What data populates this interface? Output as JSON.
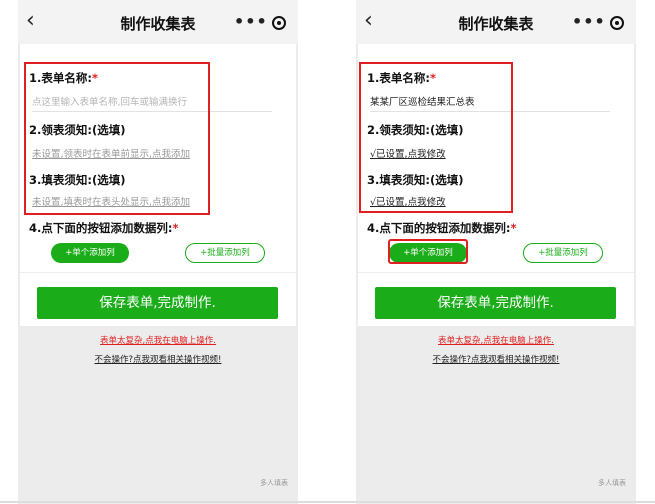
{
  "left": {
    "nav": {
      "back": "‹",
      "title": "制作收集表",
      "dots": "•••"
    },
    "form": {
      "name_label": "1.表单名称:",
      "required": "*",
      "name_placeholder": "点这里输入表单名称,回车或输满换行",
      "notice1_label": "2.领表须知:(选填)",
      "notice1_link": "未设置,领表时在表单前显示,点我添加",
      "notice2_label": "3.填表须知:(选填)",
      "notice2_link": "未设置,填表时在表头处显示,点我添加",
      "cols_label": "4.点下面的按钮添加数据列:",
      "add_single": "+单个添加列",
      "add_batch": "+批量添加列",
      "save": "保存表单,完成制作."
    },
    "link_complex": "表单太复杂,点我在电脑上操作.",
    "link_video": "不会操作?点我观看相关操作视频!",
    "watermark": "多人填表"
  },
  "right": {
    "nav": {
      "back": "‹",
      "title": "制作收集表",
      "dots": "•••"
    },
    "form": {
      "name_label": "1.表单名称:",
      "required": "*",
      "name_value": "某某厂区巡检结果汇总表",
      "notice1_label": "2.领表须知:(选填)",
      "notice1_link": "√已设置,点我修改",
      "notice2_label": "3.填表须知:(选填)",
      "notice2_link": "√已设置,点我修改",
      "cols_label": "4.点下面的按钮添加数据列:",
      "add_single": "+单个添加列",
      "add_batch": "+批量添加列",
      "save": "保存表单,完成制作."
    },
    "link_complex": "表单太复杂,点我在电脑上操作.",
    "link_video": "不会操作?点我观看相关操作视频!",
    "watermark": "多人填表"
  },
  "colors": {
    "accent": "#1aad19",
    "highlight": "#e02020",
    "required": "#e02020"
  }
}
